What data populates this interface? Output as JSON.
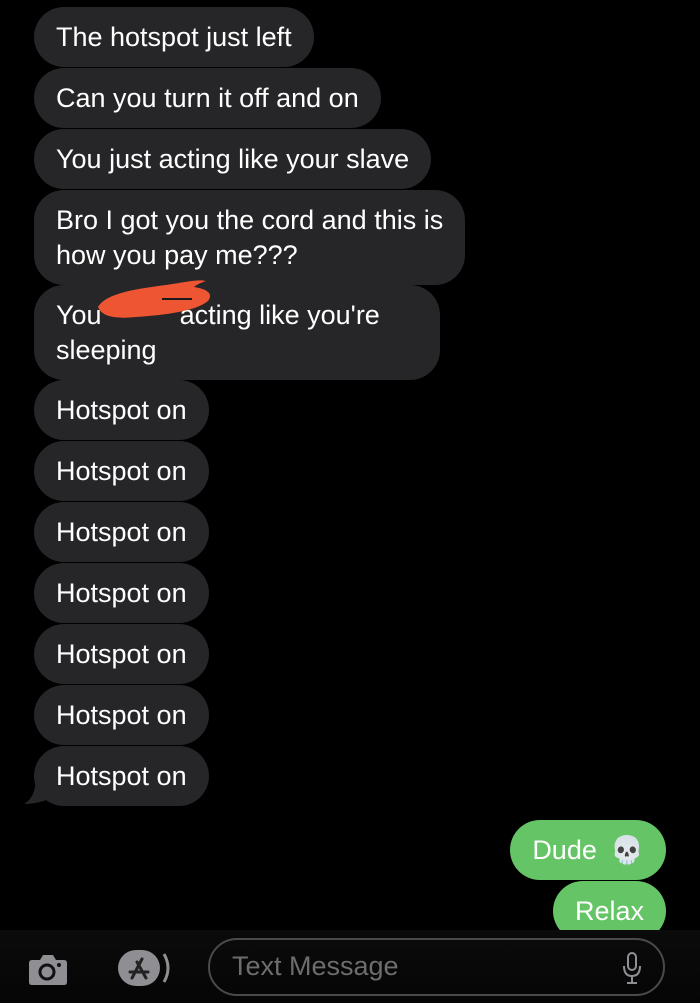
{
  "conversation": {
    "received": [
      {
        "text": "The hotspot just left"
      },
      {
        "text": "Can you turn it off and on"
      },
      {
        "text": "You just acting like your slave"
      },
      {
        "line1": "Bro I got you the cord and this is",
        "line2": "how you pay me???"
      },
      {
        "line1_prefix": "You",
        "line1_suffix": "acting like you're",
        "line2": "sleeping",
        "redacted": true
      },
      {
        "text": "Hotspot on"
      },
      {
        "text": "Hotspot on"
      },
      {
        "text": "Hotspot on"
      },
      {
        "text": "Hotspot on"
      },
      {
        "text": "Hotspot on"
      },
      {
        "text": "Hotspot on"
      },
      {
        "text": "Hotspot on"
      }
    ],
    "sent": [
      {
        "text": "Dude",
        "emoji": "💀"
      },
      {
        "text": "Relax"
      }
    ]
  },
  "composer": {
    "placeholder": "Text Message",
    "camera_icon": "camera-icon",
    "apps_icon": "app-store-icon",
    "mic_icon": "microphone-icon"
  },
  "colors": {
    "received_bubble": "#262628",
    "sent_bubble": "#65c466",
    "redaction": "#ee5533",
    "background": "#000000"
  }
}
